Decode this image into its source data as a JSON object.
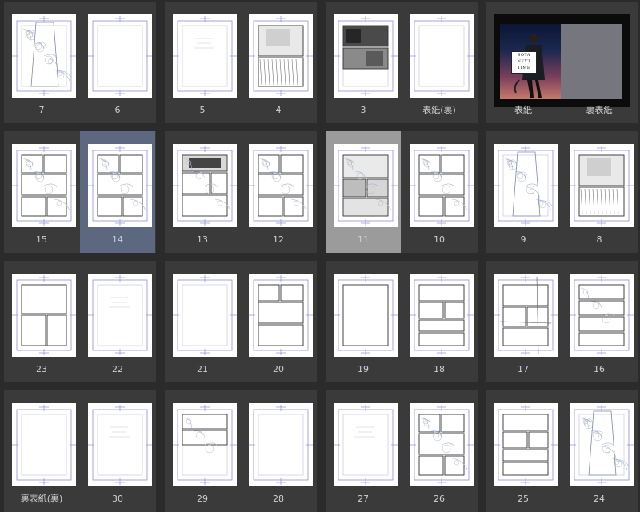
{
  "rows": [
    [
      {
        "type": "spread",
        "pages": [
          {
            "label": "7",
            "style": "sketch"
          },
          {
            "label": "6",
            "style": "blank"
          }
        ]
      },
      {
        "type": "spread",
        "pages": [
          {
            "label": "5",
            "style": "faint"
          },
          {
            "label": "4",
            "style": "inked"
          }
        ]
      },
      {
        "type": "spread",
        "pages": [
          {
            "label": "3",
            "style": "tone"
          },
          {
            "label": "表紙(裏)",
            "style": "blank"
          }
        ]
      },
      {
        "type": "cover",
        "pages": [
          {
            "label": "表紙",
            "style": "cover"
          },
          {
            "label": "裏表紙",
            "style": "cover-back"
          }
        ]
      }
    ],
    [
      {
        "type": "spread",
        "pages": [
          {
            "label": "15",
            "style": "panels-sketch"
          },
          {
            "label": "14",
            "style": "panels-sketch",
            "state": "selected"
          }
        ]
      },
      {
        "type": "spread",
        "pages": [
          {
            "label": "13",
            "style": "tone-panels"
          },
          {
            "label": "12",
            "style": "panels-sketch"
          }
        ]
      },
      {
        "type": "spread",
        "pages": [
          {
            "label": "11",
            "style": "panels-tone",
            "state": "active"
          },
          {
            "label": "10",
            "style": "panels-sketch"
          }
        ]
      },
      {
        "type": "spread",
        "pages": [
          {
            "label": "9",
            "style": "sketch"
          },
          {
            "label": "8",
            "style": "inked"
          }
        ]
      }
    ],
    [
      {
        "type": "spread",
        "pages": [
          {
            "label": "23",
            "style": "panels-3"
          },
          {
            "label": "22",
            "style": "faint"
          }
        ]
      },
      {
        "type": "spread",
        "pages": [
          {
            "label": "21",
            "style": "blank"
          },
          {
            "label": "20",
            "style": "panels-4"
          }
        ]
      },
      {
        "type": "spread",
        "pages": [
          {
            "label": "19",
            "style": "blank-frame"
          },
          {
            "label": "18",
            "style": "panels-5"
          }
        ]
      },
      {
        "type": "spread",
        "pages": [
          {
            "label": "17",
            "style": "panels-grid"
          },
          {
            "label": "16",
            "style": "panels-rows"
          }
        ]
      }
    ],
    [
      {
        "type": "spread",
        "pages": [
          {
            "label": "裏表紙(裏)",
            "style": "blank"
          },
          {
            "label": "30",
            "style": "faint"
          }
        ]
      },
      {
        "type": "spread",
        "pages": [
          {
            "label": "29",
            "style": "panels-2"
          },
          {
            "label": "28",
            "style": "blank"
          }
        ]
      },
      {
        "type": "spread",
        "pages": [
          {
            "label": "27",
            "style": "faint"
          },
          {
            "label": "26",
            "style": "panels-sketch"
          }
        ]
      },
      {
        "type": "spread",
        "pages": [
          {
            "label": "25",
            "style": "panels-5"
          },
          {
            "label": "24",
            "style": "sketch"
          }
        ]
      }
    ]
  ],
  "cover": {
    "title_lines": [
      "SOYA",
      "NEXT",
      "TIME"
    ]
  },
  "colors": {
    "background": "#2b2b2b",
    "spread_bg": "#3a3a3a",
    "selected": "#5c6780",
    "active": "#9b9b9b",
    "guide": "#8e8ed6",
    "panel": "#333333",
    "sketch": "#9fb7d9"
  }
}
